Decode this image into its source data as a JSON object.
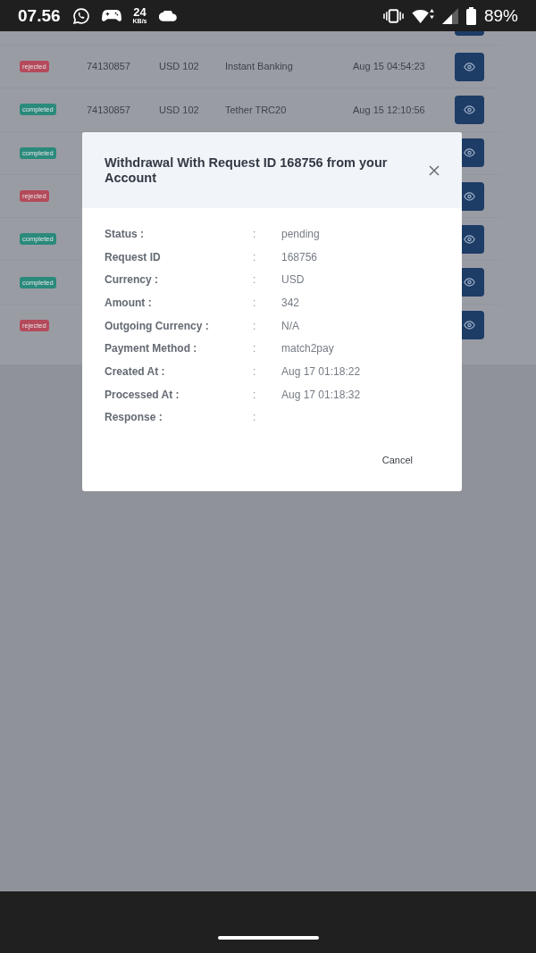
{
  "status_bar": {
    "time": "07.56",
    "network_speed": {
      "value": "24",
      "unit": "KB/s"
    },
    "battery": "89%"
  },
  "table": {
    "rows": [
      {
        "kind": "clipped"
      },
      {
        "kind": "row",
        "status": "rejected",
        "color": "#b44a5a",
        "id": "74130857",
        "amount": "USD 102",
        "method": "Instant Banking",
        "date": "Aug 15 04:54:23"
      },
      {
        "kind": "row",
        "status": "completed",
        "color": "#2a8a7b",
        "id": "74130857",
        "amount": "USD 102",
        "method": "Tether TRC20",
        "date": "Aug 15 12:10:56"
      },
      {
        "kind": "row",
        "status": "completed",
        "color": "#2a8a7b"
      },
      {
        "kind": "row",
        "status": "rejected",
        "color": "#b44a5a"
      },
      {
        "kind": "row",
        "status": "completed",
        "color": "#2a8a7b"
      },
      {
        "kind": "row",
        "status": "completed",
        "color": "#2a8a7b"
      },
      {
        "kind": "row",
        "status": "rejected",
        "color": "#b44a5a"
      }
    ]
  },
  "modal": {
    "title": "Withdrawal With Request ID 168756 from your Account",
    "fields": [
      {
        "label": "Status :",
        "separator": ":",
        "value": "pending"
      },
      {
        "label": "Request ID",
        "separator": ":",
        "value": "168756"
      },
      {
        "label": "Currency :",
        "separator": ":",
        "value": "USD"
      },
      {
        "label": "Amount :",
        "separator": ":",
        "value": "342"
      },
      {
        "label": "Outgoing Currency :",
        "separator": ":",
        "value": "N/A"
      },
      {
        "label": "Payment Method :",
        "separator": ":",
        "value": "match2pay"
      },
      {
        "label": "Created At :",
        "separator": ":",
        "value": "Aug 17 01:18:22"
      },
      {
        "label": "Processed At :",
        "separator": ":",
        "value": "Aug 17 01:18:32"
      },
      {
        "label": "Response :",
        "separator": ":"
      }
    ],
    "buttons": [
      {
        "kind": "cancel",
        "label": "Cancel"
      }
    ]
  }
}
